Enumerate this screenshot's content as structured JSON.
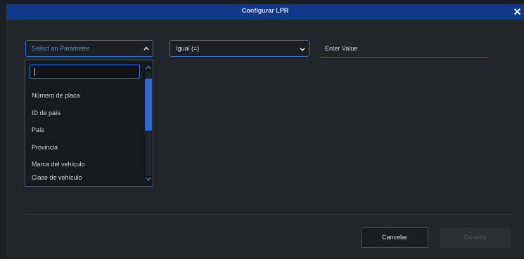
{
  "dialog": {
    "title": "Configurar LPR",
    "close_icon": "close-icon"
  },
  "filter": {
    "parameter_placeholder": "Select an Parameter",
    "operator_value": "Igual (=)",
    "value_placeholder": "Enter Value"
  },
  "dropdown": {
    "search_value": "",
    "options": [
      "Número de placa",
      "ID de país",
      "País",
      "Provincia",
      "Marca del vehículo",
      "Clase de vehículo"
    ]
  },
  "footer": {
    "cancel_label": "Cancelar",
    "save_label": "Guardar"
  },
  "colors": {
    "titlebar": "#0f3a8a",
    "accent": "#2f6fd0",
    "value_underline": "#b03034"
  }
}
